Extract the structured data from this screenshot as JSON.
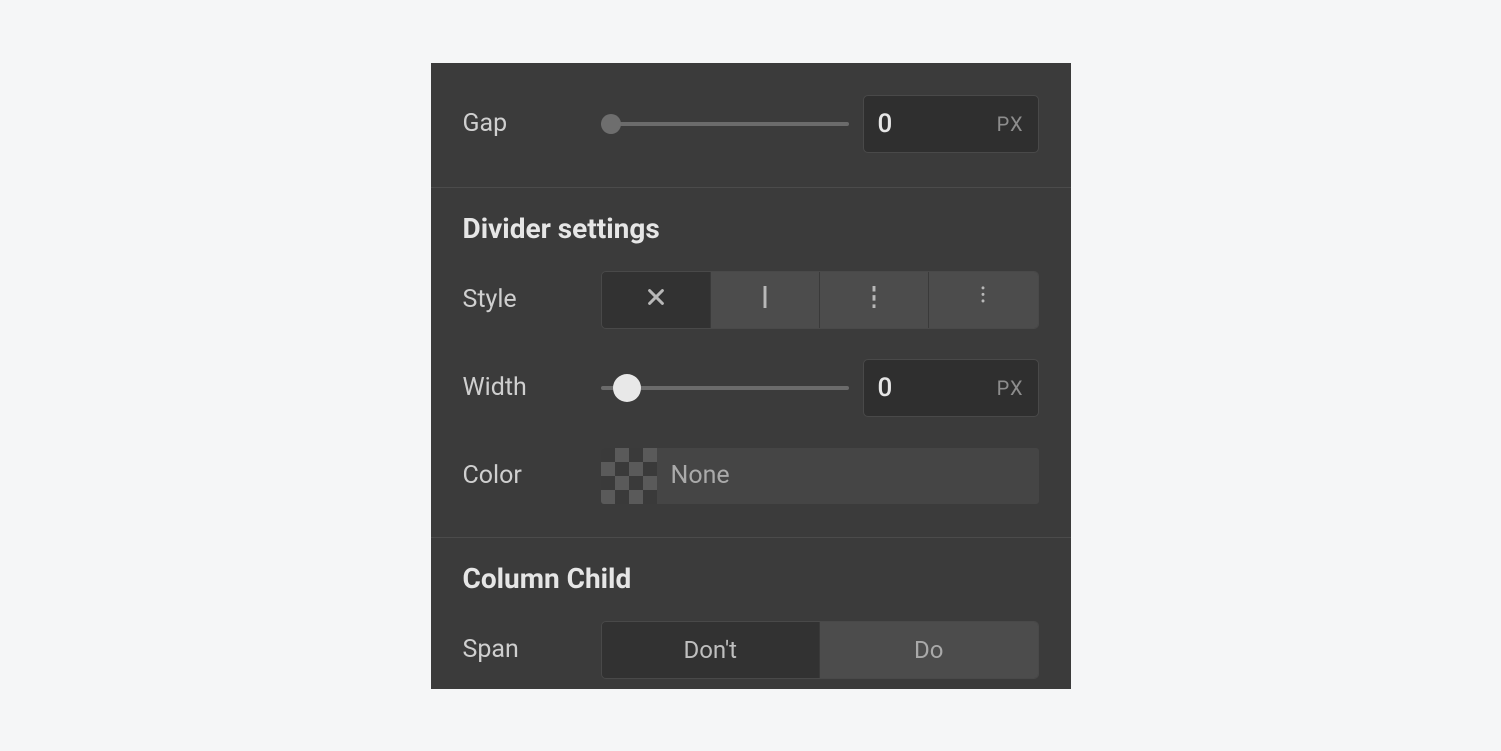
{
  "gap": {
    "label": "Gap",
    "value": "0",
    "unit": "PX"
  },
  "divider": {
    "heading": "Divider settings",
    "style": {
      "label": "Style",
      "options": [
        "none",
        "solid",
        "dashed",
        "dotted"
      ],
      "selected": "none"
    },
    "width": {
      "label": "Width",
      "value": "0",
      "unit": "PX"
    },
    "color": {
      "label": "Color",
      "value": "None"
    }
  },
  "columnChild": {
    "heading": "Column Child",
    "span": {
      "label": "Span",
      "options": [
        "Don't",
        "Do"
      ],
      "selected": "Don't"
    }
  }
}
